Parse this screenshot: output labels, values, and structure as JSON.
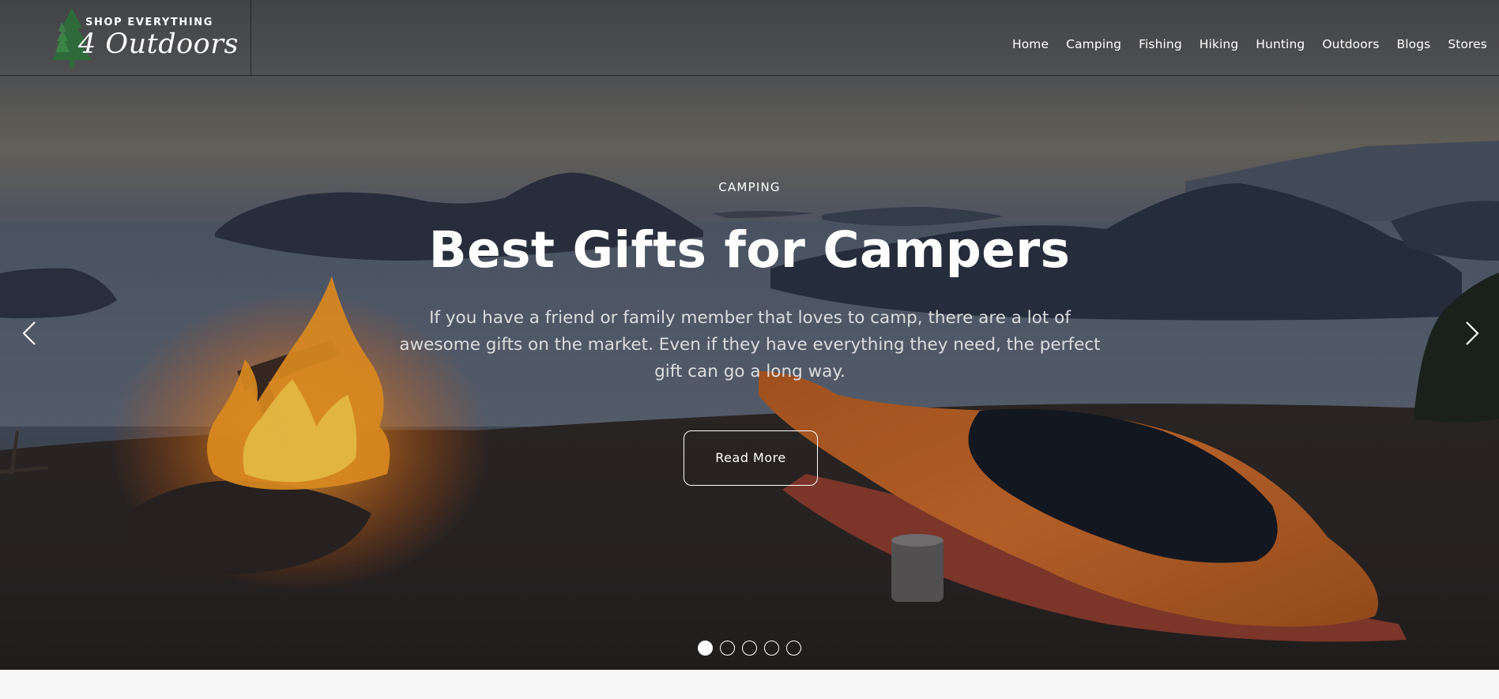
{
  "brand": {
    "tagline": "SHOP EVERYTHING",
    "name": "4 Outdoors",
    "logo_icon": "pine-tree-icon"
  },
  "nav": {
    "items": [
      {
        "label": "Home"
      },
      {
        "label": "Camping"
      },
      {
        "label": "Fishing"
      },
      {
        "label": "Hiking"
      },
      {
        "label": "Hunting"
      },
      {
        "label": "Outdoors"
      },
      {
        "label": "Blogs"
      },
      {
        "label": "Stores"
      }
    ]
  },
  "slide": {
    "category": "CAMPING",
    "title": "Best Gifts for Campers",
    "description": "If you have a friend or family member that loves to camp, there are a lot of awesome gifts on the market. Even if they have everything they need, the perfect gift can go a long way.",
    "cta_label": "Read More"
  },
  "slider": {
    "prev_icon": "chevron-left-icon",
    "next_icon": "chevron-right-icon",
    "total_slides": 5,
    "active_slide": 1
  },
  "colors": {
    "text": "#ffffff",
    "logo_tree": "#2f6b3a",
    "page_bg": "#f7f7f7"
  }
}
